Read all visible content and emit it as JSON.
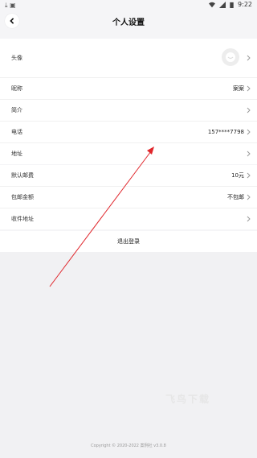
{
  "statusbar": {
    "time": "9:22"
  },
  "header": {
    "title": "个人设置"
  },
  "profile_group": [
    {
      "label": "头像",
      "value": ""
    },
    {
      "label": "昵称",
      "value": "案案"
    },
    {
      "label": "简介",
      "value": ""
    },
    {
      "label": "电话",
      "value": "157****7798"
    },
    {
      "label": "地址",
      "value": ""
    }
  ],
  "shop_group": [
    {
      "label": "默认邮费",
      "value": "10元"
    },
    {
      "label": "包邮金额",
      "value": "不包邮"
    },
    {
      "label": "收件地址",
      "value": ""
    }
  ],
  "logout_label": "退出登录",
  "footer": "Copyright © 2020-2022 案例社 v3.0.8",
  "watermark": "飞鸟下载",
  "colors": {
    "annotation_arrow": "#e0262b",
    "background": "#f5f5f7"
  }
}
